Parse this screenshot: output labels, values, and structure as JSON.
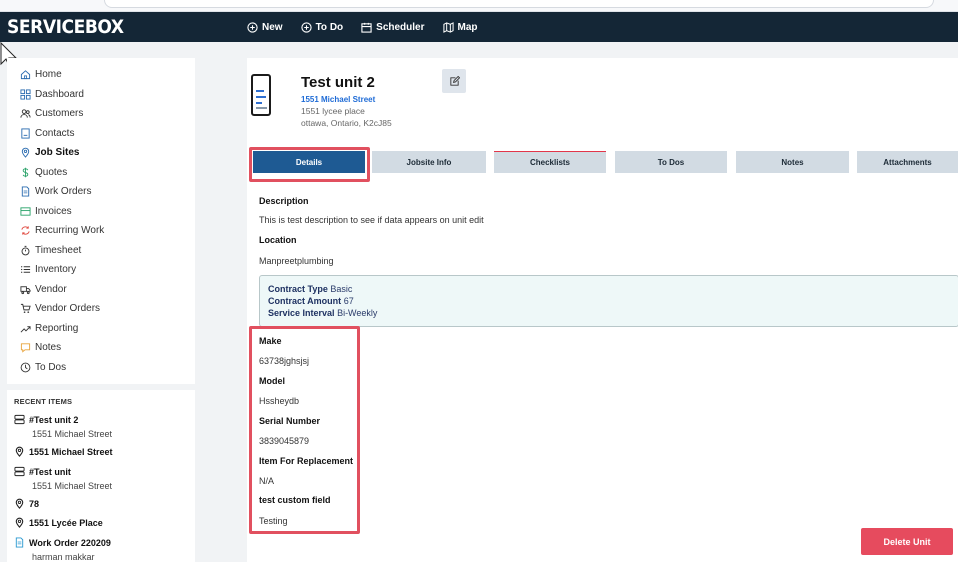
{
  "app": {
    "logo": "SERVICEBOX"
  },
  "topnav": [
    {
      "label": "New",
      "icon": "plus-circle-icon"
    },
    {
      "label": "To Do",
      "icon": "plus-circle-icon"
    },
    {
      "label": "Scheduler",
      "icon": "calendar-icon"
    },
    {
      "label": "Map",
      "icon": "map-icon"
    }
  ],
  "sidebar": {
    "items": [
      {
        "label": "Home",
        "icon": "home-icon"
      },
      {
        "label": "Dashboard",
        "icon": "grid-icon"
      },
      {
        "label": "Customers",
        "icon": "users-icon"
      },
      {
        "label": "Contacts",
        "icon": "contacts-icon"
      },
      {
        "label": "Job Sites",
        "icon": "location-pin-icon"
      },
      {
        "label": "Quotes",
        "icon": "dollar-icon"
      },
      {
        "label": "Work Orders",
        "icon": "document-icon"
      },
      {
        "label": "Invoices",
        "icon": "invoice-icon"
      },
      {
        "label": "Recurring Work",
        "icon": "recurring-icon"
      },
      {
        "label": "Timesheet",
        "icon": "stopwatch-icon"
      },
      {
        "label": "Inventory",
        "icon": "list-icon"
      },
      {
        "label": "Vendor",
        "icon": "truck-icon"
      },
      {
        "label": "Vendor Orders",
        "icon": "cart-icon"
      },
      {
        "label": "Reporting",
        "icon": "trend-icon"
      },
      {
        "label": "Notes",
        "icon": "note-icon"
      },
      {
        "label": "To Dos",
        "icon": "clock-icon"
      }
    ],
    "active_label": "Job Sites"
  },
  "recent": {
    "title": "RECENT ITEMS",
    "items": [
      {
        "label": "#Test unit 2",
        "sub": "1551 Michael Street",
        "icon": "server-icon"
      },
      {
        "label": "1551 Michael Street",
        "sub": "",
        "icon": "location-pin-icon"
      },
      {
        "label": "#Test unit",
        "sub": "1551 Michael Street",
        "icon": "server-icon"
      },
      {
        "label": "78",
        "sub": "",
        "icon": "location-pin-icon"
      },
      {
        "label": "1551 Lycée Place",
        "sub": "",
        "icon": "location-pin-icon"
      },
      {
        "label": "Work Order 220209",
        "sub": "harman makkar",
        "icon": "document-icon"
      }
    ]
  },
  "unit": {
    "title": "Test unit 2",
    "site_link": "1551 Michael Street",
    "address_line1": "1551 lycee place",
    "address_line2": "ottawa, Ontario, K2cJ85"
  },
  "tabs": [
    "Details",
    "Jobsite Info",
    "Checklists",
    "To Dos",
    "Notes",
    "Attachments"
  ],
  "details": {
    "description_label": "Description",
    "description": "This is test description to see if data appears on unit edit",
    "location_label": "Location",
    "location": "Manpreetplumbing",
    "contract": {
      "type_label": "Contract Type",
      "type": "Basic",
      "amount_label": "Contract Amount",
      "amount": "67",
      "interval_label": "Service Interval",
      "interval": "Bi-Weekly"
    },
    "fields": [
      {
        "label": "Make",
        "value": "63738jghsjsj"
      },
      {
        "label": "Model",
        "value": "Hssheydb"
      },
      {
        "label": "Serial Number",
        "value": "3839045879"
      },
      {
        "label": "Item For Replacement",
        "value": "N/A"
      },
      {
        "label": "test custom field",
        "value": "Testing"
      }
    ]
  },
  "actions": {
    "delete_label": "Delete Unit"
  },
  "colors": {
    "topbar": "#142636",
    "active_tab": "#1e5a93",
    "tab": "#d2dbe3",
    "link": "#1e6bd6",
    "delete": "#e64b5e",
    "highlight": "#e1505f"
  }
}
